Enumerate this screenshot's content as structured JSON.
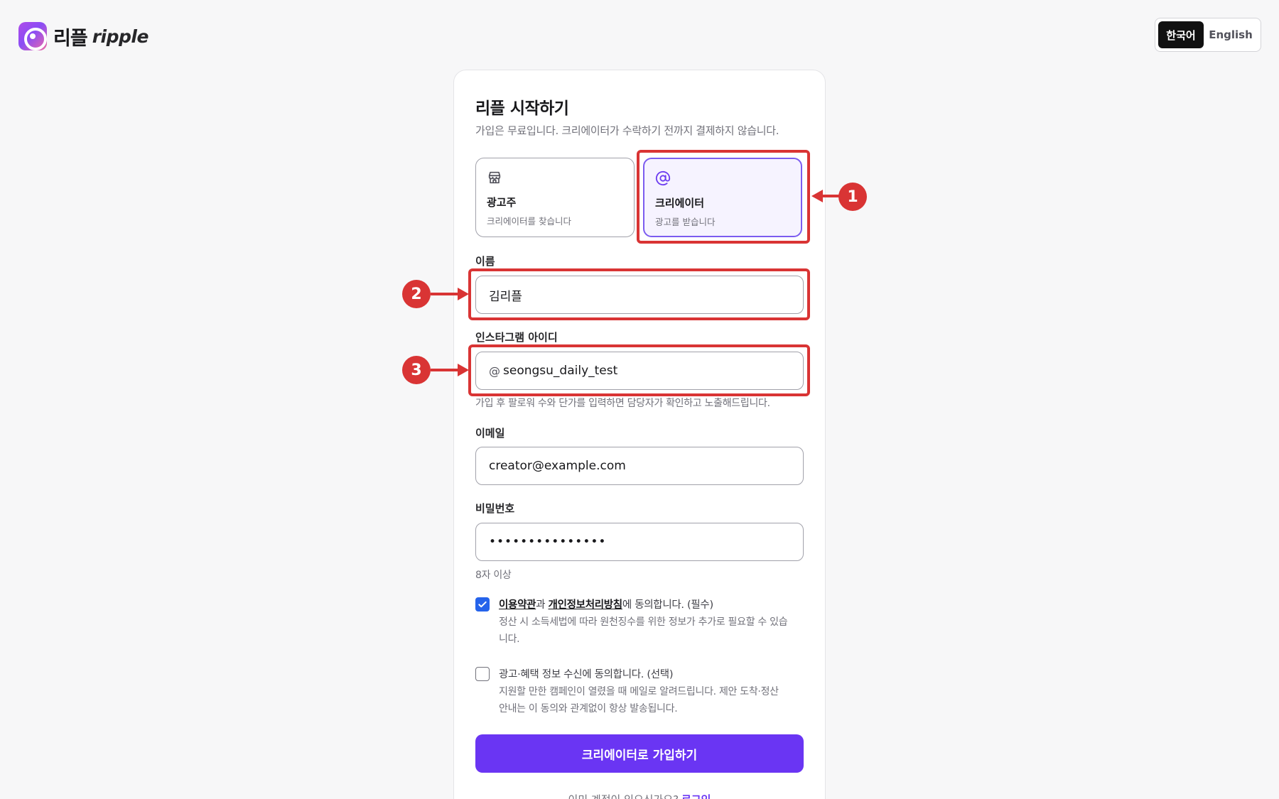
{
  "brand": {
    "name_ko": "리플",
    "name_en": "ripple"
  },
  "language": {
    "korean": "한국어",
    "english": "English",
    "selected": "한국어"
  },
  "form": {
    "title": "리플 시작하기",
    "subtitle": "가입은 무료입니다. 크리에이터가 수락하기 전까지 결제하지 않습니다.",
    "roles": {
      "advertiser": {
        "title": "광고주",
        "desc": "크리에이터를 찾습니다",
        "icon": "store-icon"
      },
      "creator": {
        "title": "크리에이터",
        "desc": "광고를 받습니다",
        "icon": "at-icon",
        "selected": true
      }
    },
    "name": {
      "label": "이름",
      "value": "김리플"
    },
    "instagram": {
      "label": "인스타그램 아이디",
      "prefix": "@",
      "value": "seongsu_daily_test",
      "hint": "가입 후 팔로워 수와 단가를 입력하면 담당자가 확인하고 노출해드립니다."
    },
    "email": {
      "label": "이메일",
      "value": "creator@example.com"
    },
    "password": {
      "label": "비밀번호",
      "value": "•••••••••••••••",
      "hint": "8자 이상"
    },
    "terms": {
      "checked": true,
      "link1": "이용약관",
      "joiner": "과 ",
      "link2": "개인정보처리방침",
      "suffix": "에 동의합니다. (필수)",
      "note": "정산 시 소득세법에 따라 원천징수를 위한 정보가 추가로 필요할 수 있습니다."
    },
    "marketing": {
      "checked": false,
      "label": "광고·혜택 정보 수신에 동의합니다. (선택)",
      "note": "지원할 만한 캠페인이 열렸을 때 메일로 알려드립니다. 제안 도착·정산 안내는 이 동의와 관계없이 항상 발송됩니다."
    },
    "submit": "크리에이터로 가입하기",
    "login_prompt": "이미 계정이 있으신가요?",
    "login_link": "로그인"
  },
  "annotations": [
    "1",
    "2",
    "3"
  ],
  "colors": {
    "primary": "#6a35f3",
    "annotation": "#d93434",
    "checkbox": "#2563eb"
  }
}
